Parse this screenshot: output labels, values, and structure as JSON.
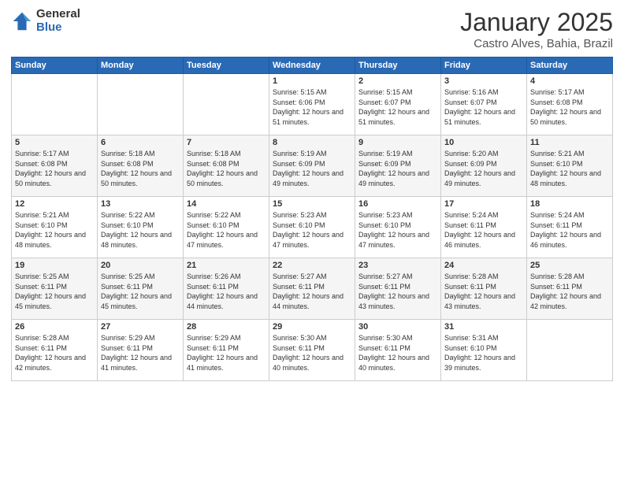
{
  "logo": {
    "general": "General",
    "blue": "Blue"
  },
  "header": {
    "month": "January 2025",
    "location": "Castro Alves, Bahia, Brazil"
  },
  "weekdays": [
    "Sunday",
    "Monday",
    "Tuesday",
    "Wednesday",
    "Thursday",
    "Friday",
    "Saturday"
  ],
  "weeks": [
    [
      {
        "day": "",
        "sunrise": "",
        "sunset": "",
        "daylight": ""
      },
      {
        "day": "",
        "sunrise": "",
        "sunset": "",
        "daylight": ""
      },
      {
        "day": "",
        "sunrise": "",
        "sunset": "",
        "daylight": ""
      },
      {
        "day": "1",
        "sunrise": "Sunrise: 5:15 AM",
        "sunset": "Sunset: 6:06 PM",
        "daylight": "Daylight: 12 hours and 51 minutes."
      },
      {
        "day": "2",
        "sunrise": "Sunrise: 5:15 AM",
        "sunset": "Sunset: 6:07 PM",
        "daylight": "Daylight: 12 hours and 51 minutes."
      },
      {
        "day": "3",
        "sunrise": "Sunrise: 5:16 AM",
        "sunset": "Sunset: 6:07 PM",
        "daylight": "Daylight: 12 hours and 51 minutes."
      },
      {
        "day": "4",
        "sunrise": "Sunrise: 5:17 AM",
        "sunset": "Sunset: 6:08 PM",
        "daylight": "Daylight: 12 hours and 50 minutes."
      }
    ],
    [
      {
        "day": "5",
        "sunrise": "Sunrise: 5:17 AM",
        "sunset": "Sunset: 6:08 PM",
        "daylight": "Daylight: 12 hours and 50 minutes."
      },
      {
        "day": "6",
        "sunrise": "Sunrise: 5:18 AM",
        "sunset": "Sunset: 6:08 PM",
        "daylight": "Daylight: 12 hours and 50 minutes."
      },
      {
        "day": "7",
        "sunrise": "Sunrise: 5:18 AM",
        "sunset": "Sunset: 6:08 PM",
        "daylight": "Daylight: 12 hours and 50 minutes."
      },
      {
        "day": "8",
        "sunrise": "Sunrise: 5:19 AM",
        "sunset": "Sunset: 6:09 PM",
        "daylight": "Daylight: 12 hours and 49 minutes."
      },
      {
        "day": "9",
        "sunrise": "Sunrise: 5:19 AM",
        "sunset": "Sunset: 6:09 PM",
        "daylight": "Daylight: 12 hours and 49 minutes."
      },
      {
        "day": "10",
        "sunrise": "Sunrise: 5:20 AM",
        "sunset": "Sunset: 6:09 PM",
        "daylight": "Daylight: 12 hours and 49 minutes."
      },
      {
        "day": "11",
        "sunrise": "Sunrise: 5:21 AM",
        "sunset": "Sunset: 6:10 PM",
        "daylight": "Daylight: 12 hours and 48 minutes."
      }
    ],
    [
      {
        "day": "12",
        "sunrise": "Sunrise: 5:21 AM",
        "sunset": "Sunset: 6:10 PM",
        "daylight": "Daylight: 12 hours and 48 minutes."
      },
      {
        "day": "13",
        "sunrise": "Sunrise: 5:22 AM",
        "sunset": "Sunset: 6:10 PM",
        "daylight": "Daylight: 12 hours and 48 minutes."
      },
      {
        "day": "14",
        "sunrise": "Sunrise: 5:22 AM",
        "sunset": "Sunset: 6:10 PM",
        "daylight": "Daylight: 12 hours and 47 minutes."
      },
      {
        "day": "15",
        "sunrise": "Sunrise: 5:23 AM",
        "sunset": "Sunset: 6:10 PM",
        "daylight": "Daylight: 12 hours and 47 minutes."
      },
      {
        "day": "16",
        "sunrise": "Sunrise: 5:23 AM",
        "sunset": "Sunset: 6:10 PM",
        "daylight": "Daylight: 12 hours and 47 minutes."
      },
      {
        "day": "17",
        "sunrise": "Sunrise: 5:24 AM",
        "sunset": "Sunset: 6:11 PM",
        "daylight": "Daylight: 12 hours and 46 minutes."
      },
      {
        "day": "18",
        "sunrise": "Sunrise: 5:24 AM",
        "sunset": "Sunset: 6:11 PM",
        "daylight": "Daylight: 12 hours and 46 minutes."
      }
    ],
    [
      {
        "day": "19",
        "sunrise": "Sunrise: 5:25 AM",
        "sunset": "Sunset: 6:11 PM",
        "daylight": "Daylight: 12 hours and 45 minutes."
      },
      {
        "day": "20",
        "sunrise": "Sunrise: 5:25 AM",
        "sunset": "Sunset: 6:11 PM",
        "daylight": "Daylight: 12 hours and 45 minutes."
      },
      {
        "day": "21",
        "sunrise": "Sunrise: 5:26 AM",
        "sunset": "Sunset: 6:11 PM",
        "daylight": "Daylight: 12 hours and 44 minutes."
      },
      {
        "day": "22",
        "sunrise": "Sunrise: 5:27 AM",
        "sunset": "Sunset: 6:11 PM",
        "daylight": "Daylight: 12 hours and 44 minutes."
      },
      {
        "day": "23",
        "sunrise": "Sunrise: 5:27 AM",
        "sunset": "Sunset: 6:11 PM",
        "daylight": "Daylight: 12 hours and 43 minutes."
      },
      {
        "day": "24",
        "sunrise": "Sunrise: 5:28 AM",
        "sunset": "Sunset: 6:11 PM",
        "daylight": "Daylight: 12 hours and 43 minutes."
      },
      {
        "day": "25",
        "sunrise": "Sunrise: 5:28 AM",
        "sunset": "Sunset: 6:11 PM",
        "daylight": "Daylight: 12 hours and 42 minutes."
      }
    ],
    [
      {
        "day": "26",
        "sunrise": "Sunrise: 5:28 AM",
        "sunset": "Sunset: 6:11 PM",
        "daylight": "Daylight: 12 hours and 42 minutes."
      },
      {
        "day": "27",
        "sunrise": "Sunrise: 5:29 AM",
        "sunset": "Sunset: 6:11 PM",
        "daylight": "Daylight: 12 hours and 41 minutes."
      },
      {
        "day": "28",
        "sunrise": "Sunrise: 5:29 AM",
        "sunset": "Sunset: 6:11 PM",
        "daylight": "Daylight: 12 hours and 41 minutes."
      },
      {
        "day": "29",
        "sunrise": "Sunrise: 5:30 AM",
        "sunset": "Sunset: 6:11 PM",
        "daylight": "Daylight: 12 hours and 40 minutes."
      },
      {
        "day": "30",
        "sunrise": "Sunrise: 5:30 AM",
        "sunset": "Sunset: 6:11 PM",
        "daylight": "Daylight: 12 hours and 40 minutes."
      },
      {
        "day": "31",
        "sunrise": "Sunrise: 5:31 AM",
        "sunset": "Sunset: 6:10 PM",
        "daylight": "Daylight: 12 hours and 39 minutes."
      },
      {
        "day": "",
        "sunrise": "",
        "sunset": "",
        "daylight": ""
      }
    ]
  ]
}
